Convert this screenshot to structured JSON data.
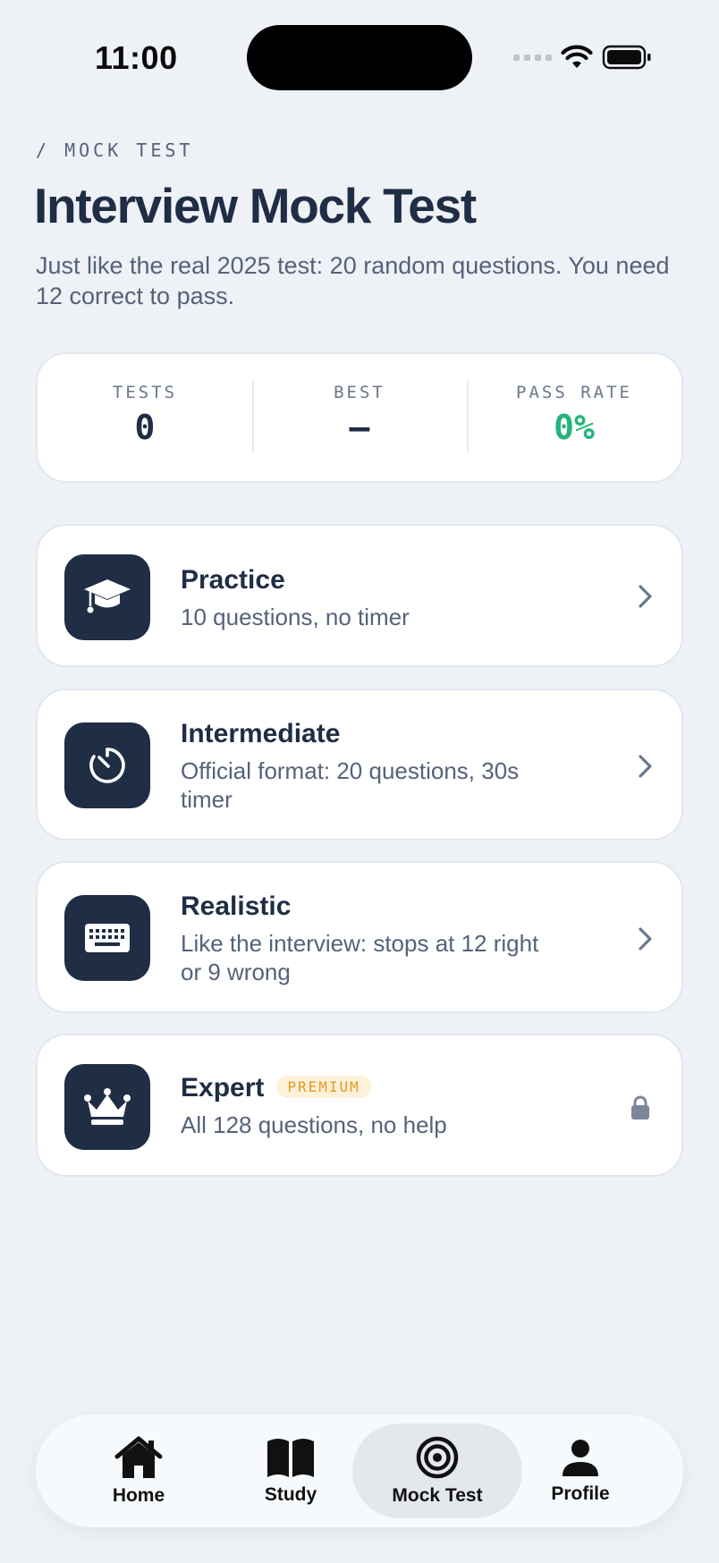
{
  "status_bar": {
    "time": "11:00"
  },
  "header": {
    "breadcrumb": "/ MOCK TEST",
    "title": "Interview Mock Test",
    "subtitle": "Just like the real 2025 test: 20 random questions. You need 12 correct to pass."
  },
  "stats": [
    {
      "label": "TESTS",
      "value": "0"
    },
    {
      "label": "BEST",
      "value": "—"
    },
    {
      "label": "PASS RATE",
      "value": "0%"
    }
  ],
  "modes": [
    {
      "title": "Practice",
      "description": "10 questions, no timer",
      "icon": "graduation-cap-icon"
    },
    {
      "title": "Intermediate",
      "description": "Official format: 20 questions, 30s timer",
      "icon": "timer-icon"
    },
    {
      "title": "Realistic",
      "description": "Like the interview: stops at 12 right or 9 wrong",
      "icon": "keyboard-icon"
    },
    {
      "title": "Expert",
      "badge": "PREMIUM",
      "description": "All 128 questions, no help",
      "icon": "crown-icon",
      "locked": true
    }
  ],
  "tabs": [
    {
      "label": "Home",
      "icon": "home-icon"
    },
    {
      "label": "Study",
      "icon": "book-icon"
    },
    {
      "label": "Mock Test",
      "icon": "target-icon",
      "active": true
    },
    {
      "label": "Profile",
      "icon": "person-icon"
    }
  ],
  "colors": {
    "background": "#eef1f6",
    "primary": "#1f2d45",
    "muted": "#55627a",
    "success": "#27b47c",
    "premium_bg": "#fdf1d9",
    "premium_text": "#e59a1f"
  }
}
